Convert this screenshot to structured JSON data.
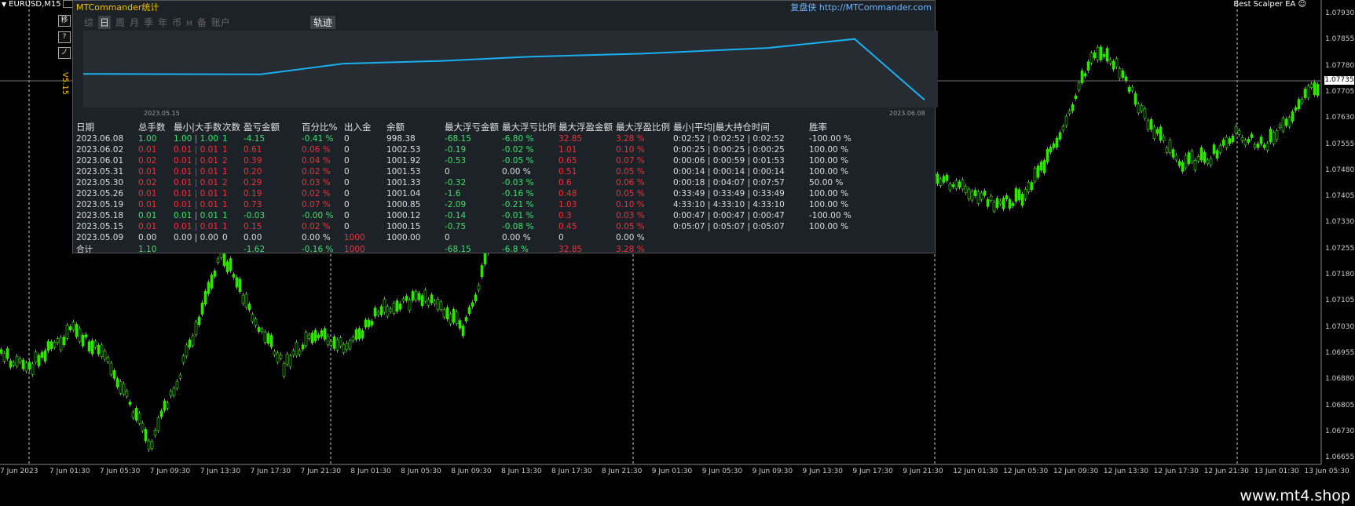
{
  "window": {
    "symbol": "EURUSD,M15",
    "ea_label": "Best Scalper EA ☺"
  },
  "side_buttons": [
    "移",
    "?",
    "ノ"
  ],
  "version": "V5.15",
  "panel": {
    "title": "MTCommander统计",
    "site": "复盘侠 http://MTCommander.com",
    "tabs": [
      "综",
      "日",
      "周",
      "月",
      "季",
      "年",
      "币",
      "M",
      "备",
      "账户"
    ],
    "active_tab": "日",
    "track": "轨迹",
    "date_start": "2023.05.15",
    "date_end": "2023.06.08",
    "equity_curve": [
      1000.15,
      1000.12,
      1000.85,
      1001.04,
      1001.33,
      1001.53,
      1001.92,
      1002.53,
      998.38
    ]
  },
  "table": {
    "headers": [
      "日期",
      "总手数",
      "最小|大手数",
      "次数",
      "盈亏金额",
      "百分比%",
      "出入金",
      "余额",
      "最大浮亏金额",
      "最大浮亏比例",
      "最大浮盈金额",
      "最大浮盈比例",
      "最小|平均|最大持仓时间",
      "胜率"
    ],
    "rows": [
      [
        "2023.06.08",
        "1.00",
        "1.00 | 1.00",
        "1",
        "-4.15",
        "-0.41 %",
        "0",
        "998.38",
        "-68.15",
        "-6.80 %",
        "32.85",
        "3.28 %",
        "0:02:52 | 0:02:52 | 0:02:52",
        "-100.00 %"
      ],
      [
        "2023.06.02",
        "0.01",
        "0.01 | 0.01",
        "1",
        "0.61",
        "0.06 %",
        "0",
        "1002.53",
        "-0.19",
        "-0.02 %",
        "1.01",
        "0.10 %",
        "0:00:25 | 0:00:25 | 0:00:25",
        "100.00 %"
      ],
      [
        "2023.06.01",
        "0.02",
        "0.01 | 0.01",
        "2",
        "0.39",
        "0.04 %",
        "0",
        "1001.92",
        "-0.53",
        "-0.05 %",
        "0.65",
        "0.07 %",
        "0:00:06 | 0:00:59 | 0:01:53",
        "100.00 %"
      ],
      [
        "2023.05.31",
        "0.01",
        "0.01 | 0.01",
        "1",
        "0.20",
        "0.02 %",
        "0",
        "1001.53",
        "0",
        "0.00 %",
        "0.51",
        "0.05 %",
        "0:00:14 | 0:00:14 | 0:00:14",
        "100.00 %"
      ],
      [
        "2023.05.30",
        "0.02",
        "0.01 | 0.01",
        "2",
        "0.29",
        "0.03 %",
        "0",
        "1001.33",
        "-0.32",
        "-0.03 %",
        "0.6",
        "0.06 %",
        "0:00:18 | 0:04:07 | 0:07:57",
        "50.00 %"
      ],
      [
        "2023.05.26",
        "0.01",
        "0.01 | 0.01",
        "1",
        "0.19",
        "0.02 %",
        "0",
        "1001.04",
        "-1.6",
        "-0.16 %",
        "0.48",
        "0.05 %",
        "0:33:49 | 0:33:49 | 0:33:49",
        "100.00 %"
      ],
      [
        "2023.05.19",
        "0.01",
        "0.01 | 0.01",
        "1",
        "0.73",
        "0.07 %",
        "0",
        "1000.85",
        "-2.09",
        "-0.21 %",
        "1.03",
        "0.10 %",
        "4:33:10 | 4:33:10 | 4:33:10",
        "100.00 %"
      ],
      [
        "2023.05.18",
        "0.01",
        "0.01 | 0.01",
        "1",
        "-0.03",
        "-0.00 %",
        "0",
        "1000.12",
        "-0.14",
        "-0.01 %",
        "0.3",
        "0.03 %",
        "0:00:47 | 0:00:47 | 0:00:47",
        "-100.00 %"
      ],
      [
        "2023.05.15",
        "0.01",
        "0.01 | 0.01",
        "1",
        "0.15",
        "0.02 %",
        "0",
        "1000.15",
        "-0.75",
        "-0.08 %",
        "0.45",
        "0.05 %",
        "0:05:07 | 0:05:07 | 0:05:07",
        "100.00 %"
      ],
      [
        "2023.05.09",
        "0.00",
        "0.00 | 0.00",
        "0",
        "0.00",
        "0.00 %",
        "1000",
        "1000.00",
        "0",
        "0.00 %",
        "0",
        "0.00 %",
        "",
        ""
      ]
    ],
    "total": [
      "合计",
      "1.10",
      "",
      "",
      "-1.62",
      "-0.16 %",
      "1000",
      "",
      "-68.15",
      "-6.8 %",
      "32.85",
      "3.28 %",
      "",
      ""
    ]
  },
  "price_axis": [
    "1.07930",
    "1.07855",
    "1.07780",
    "1.07705",
    "1.07630",
    "1.07555",
    "1.07480",
    "1.07405",
    "1.07330",
    "1.07255",
    "1.07180",
    "1.07105",
    "1.07030",
    "1.06955",
    "1.06880",
    "1.06805",
    "1.06730",
    "1.06655"
  ],
  "current_price": "1.07735",
  "time_axis": [
    "7 Jun 2023",
    "7 Jun 01:30",
    "7 Jun 05:30",
    "7 Jun 09:30",
    "7 Jun 13:30",
    "7 Jun 17:30",
    "7 Jun 21:30",
    "8 Jun 01:30",
    "8 Jun 05:30",
    "8 Jun 09:30",
    "8 Jun 13:30",
    "8 Jun 17:30",
    "8 Jun 21:30",
    "9 Jun 01:30",
    "9 Jun 05:30",
    "9 Jun 09:30",
    "9 Jun 13:30",
    "9 Jun 17:30",
    "9 Jun 21:30",
    "12 Jun 01:30",
    "12 Jun 05:30",
    "12 Jun 09:30",
    "12 Jun 13:30",
    "12 Jun 17:30",
    "12 Jun 21:30",
    "13 Jun 01:30",
    "13 Jun 05:30"
  ],
  "watermark": "www.mt4.shop",
  "colors": {
    "candle": "#36e000",
    "equity": "#1ab0f0",
    "profit": "#3ee06a",
    "loss": "#f0303a"
  }
}
